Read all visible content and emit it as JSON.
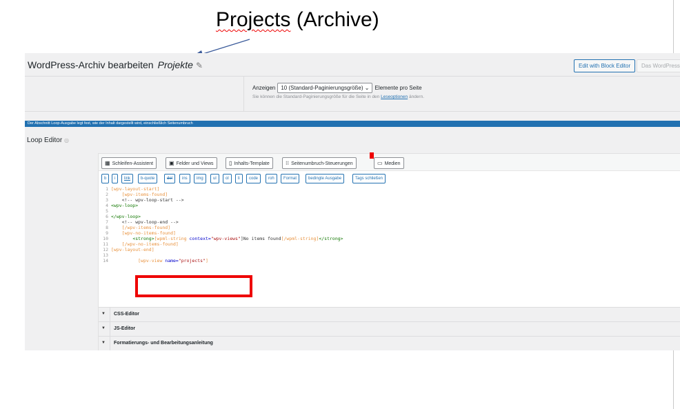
{
  "annotation": {
    "title_word": "Projects",
    "title_rest": " (Archive)"
  },
  "header": {
    "title": "WordPress-Archiv bearbeiten",
    "archive_name": "Projekte",
    "edit_block_button": "Edit with Block Editor",
    "wp_button": "Das WordPress-Archiv"
  },
  "pagination": {
    "show_label": "Anzeigen",
    "selected": "10 (Standard-Paginierungsgröße)",
    "suffix": "Elemente pro Seite",
    "help_prefix": "Sie können die Standard-Paginierungsgröße für die Seite in den ",
    "help_link": "Leseoptionen",
    "help_suffix": " ändern."
  },
  "notice": "Der Abschnitt Loop-Ausgabe legt fest, wie der Inhalt dargestellt wird, einschließlich Seitenumbruch",
  "loop_editor": {
    "title": "Loop Editor",
    "toolbar": {
      "loop_wizard": "Schleifen-Assistent",
      "fields_views": "Felder und Views",
      "content_template": "Inhalts-Template",
      "pagination_controls": "Seitenumbruch-Steuerungen",
      "media": "Medien"
    },
    "quicktags": [
      "b",
      "i",
      "link",
      "b-quote",
      "del",
      "ins",
      "img",
      "ul",
      "ol",
      "li",
      "code",
      "roh",
      "Format",
      "bedingte Ausgabe",
      "Tags schließen"
    ],
    "code_lines": [
      {
        "n": "1",
        "text": "[wpv-layout-start]"
      },
      {
        "n": "2",
        "text": "[wpv-items-found]"
      },
      {
        "n": "3",
        "text": "<!-- wpv-loop-start -->"
      },
      {
        "n": "4",
        "text": "<wpv-loop>"
      },
      {
        "n": "5",
        "text": ""
      },
      {
        "n": "6",
        "text": "</wpv-loop>"
      },
      {
        "n": "7",
        "text": "<!-- wpv-loop-end -->"
      },
      {
        "n": "8",
        "text": "[/wpv-items-found]"
      },
      {
        "n": "9",
        "text": "[wpv-no-items-found]"
      },
      {
        "n": "10",
        "text_a": "<strong>",
        "text_b": "[wpml-string ",
        "text_c": "context=",
        "text_d": "\"wpv-views\"",
        "text_e": "]No items found",
        "text_f": "[/wpml-string]",
        "text_g": "</strong>"
      },
      {
        "n": "11",
        "text": "[/wpv-no-items-found]"
      },
      {
        "n": "12",
        "text": "[wpv-layout-end]"
      },
      {
        "n": "13",
        "text": ""
      },
      {
        "n": "14",
        "text_a": "[wpv-view ",
        "text_b": "name=",
        "text_c": "\"projects\"",
        "text_d": "]"
      }
    ]
  },
  "accordions": {
    "css": "CSS-Editor",
    "js": "JS-Editor",
    "format": "Formatierungs- und Bearbeitungsanleitung"
  }
}
